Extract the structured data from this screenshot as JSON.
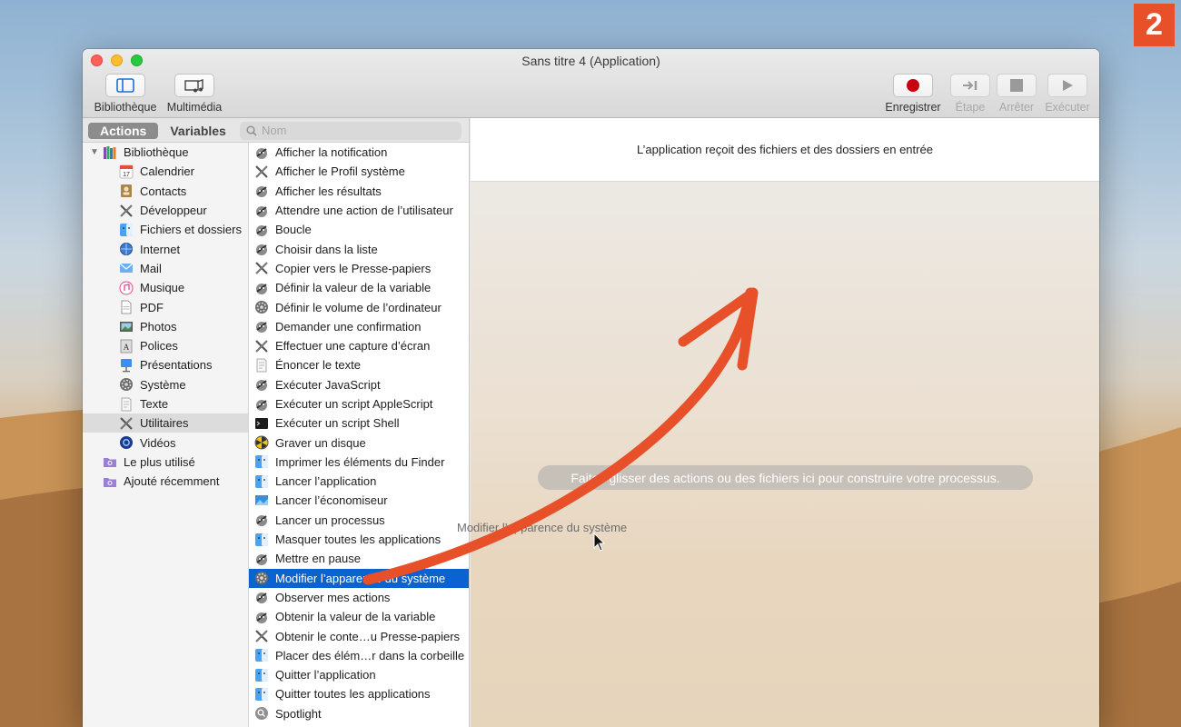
{
  "badge": "2",
  "window": {
    "title": "Sans titre 4 (Application)"
  },
  "toolbar": {
    "left": [
      {
        "label": "Bibliothèque",
        "icon": "library-icon"
      },
      {
        "label": "Multimédia",
        "icon": "media-icon"
      }
    ],
    "right": [
      {
        "label": "Enregistrer",
        "icon": "record-icon",
        "enabled": true
      },
      {
        "label": "Étape",
        "icon": "step-icon",
        "enabled": false
      },
      {
        "label": "Arrêter",
        "icon": "stop-icon",
        "enabled": false
      },
      {
        "label": "Exécuter",
        "icon": "run-icon",
        "enabled": false
      }
    ]
  },
  "library": {
    "tabs": {
      "actions": "Actions",
      "variables": "Variables"
    },
    "search_placeholder": "Nom",
    "categories": [
      {
        "label": "Bibliothèque",
        "icon": "books-icon",
        "level": 0,
        "expanded": true
      },
      {
        "label": "Calendrier",
        "icon": "calendar-icon",
        "level": 1
      },
      {
        "label": "Contacts",
        "icon": "contacts-icon",
        "level": 1
      },
      {
        "label": "Développeur",
        "icon": "tools-icon",
        "level": 1
      },
      {
        "label": "Fichiers et dossiers",
        "icon": "finder-icon",
        "level": 1
      },
      {
        "label": "Internet",
        "icon": "globe-icon",
        "level": 1
      },
      {
        "label": "Mail",
        "icon": "mail-icon",
        "level": 1
      },
      {
        "label": "Musique",
        "icon": "music-icon",
        "level": 1
      },
      {
        "label": "PDF",
        "icon": "pdf-icon",
        "level": 1
      },
      {
        "label": "Photos",
        "icon": "photos-icon",
        "level": 1
      },
      {
        "label": "Polices",
        "icon": "fonts-icon",
        "level": 1
      },
      {
        "label": "Présentations",
        "icon": "keynote-icon",
        "level": 1
      },
      {
        "label": "Système",
        "icon": "gear-icon",
        "level": 1
      },
      {
        "label": "Texte",
        "icon": "text-icon",
        "level": 1
      },
      {
        "label": "Utilitaires",
        "icon": "tools-icon",
        "level": 1,
        "selected": true
      },
      {
        "label": "Vidéos",
        "icon": "video-icon",
        "level": 1
      },
      {
        "label": "Le plus utilisé",
        "icon": "smart-folder-icon",
        "level": 0
      },
      {
        "label": "Ajouté récemment",
        "icon": "smart-folder-icon",
        "level": 0
      }
    ],
    "actions": [
      {
        "label": "Afficher la notification",
        "icon": "automator-icon"
      },
      {
        "label": "Afficher le Profil système",
        "icon": "tools-icon"
      },
      {
        "label": "Afficher les résultats",
        "icon": "automator-icon"
      },
      {
        "label": "Attendre une action de l’utilisateur",
        "icon": "automator-icon"
      },
      {
        "label": "Boucle",
        "icon": "automator-icon"
      },
      {
        "label": "Choisir dans la liste",
        "icon": "automator-icon"
      },
      {
        "label": "Copier vers le Presse-papiers",
        "icon": "tools-icon"
      },
      {
        "label": "Définir la valeur de la variable",
        "icon": "automator-icon"
      },
      {
        "label": "Définir le volume de l’ordinateur",
        "icon": "gear-icon"
      },
      {
        "label": "Demander une confirmation",
        "icon": "automator-icon"
      },
      {
        "label": "Effectuer une capture d’écran",
        "icon": "tools-icon"
      },
      {
        "label": "Énoncer le texte",
        "icon": "text-icon"
      },
      {
        "label": "Exécuter JavaScript",
        "icon": "automator-icon"
      },
      {
        "label": "Exécuter un script AppleScript",
        "icon": "automator-icon"
      },
      {
        "label": "Exécuter un script Shell",
        "icon": "terminal-icon"
      },
      {
        "label": "Graver un disque",
        "icon": "burn-icon"
      },
      {
        "label": "Imprimer les éléments du Finder",
        "icon": "finder-icon"
      },
      {
        "label": "Lancer l’application",
        "icon": "finder-icon"
      },
      {
        "label": "Lancer l’économiseur",
        "icon": "screensaver-icon"
      },
      {
        "label": "Lancer un processus",
        "icon": "automator-icon"
      },
      {
        "label": "Masquer toutes les applications",
        "icon": "finder-icon"
      },
      {
        "label": "Mettre en pause",
        "icon": "automator-icon"
      },
      {
        "label": "Modifier l’apparence du système",
        "icon": "gear-icon",
        "selected": true
      },
      {
        "label": "Observer mes actions",
        "icon": "automator-icon"
      },
      {
        "label": "Obtenir la valeur de la variable",
        "icon": "automator-icon"
      },
      {
        "label": "Obtenir le conte…u Presse-papiers",
        "icon": "tools-icon"
      },
      {
        "label": "Placer des élém…r dans la corbeille",
        "icon": "finder-icon"
      },
      {
        "label": "Quitter l’application",
        "icon": "finder-icon"
      },
      {
        "label": "Quitter toutes les applications",
        "icon": "finder-icon"
      },
      {
        "label": "Spotlight",
        "icon": "search-icon"
      }
    ]
  },
  "workflow": {
    "header": "L’application reçoit des fichiers et des dossiers en entrée",
    "drop_hint": "Faites glisser des actions ou des fichiers ici pour construire votre processus.",
    "drag_label": "Modifier l’apparence du système"
  },
  "colors": {
    "accent": "#0a63d1",
    "arrow": "#e8502a",
    "record": "#d0021b"
  }
}
